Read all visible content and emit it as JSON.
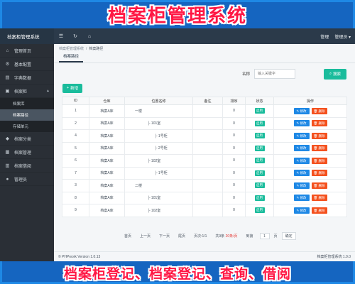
{
  "banner": {
    "top": "档案柜管理系统",
    "bottom": "档案柜登记、档案登记、查询、借阅"
  },
  "topbar": {
    "brand": "档案柜管理系统",
    "right_manage": "管理",
    "right_user": "管理员 ▾"
  },
  "sidebar": {
    "items": [
      {
        "label": "管理首页",
        "icon": "home-icon"
      },
      {
        "label": "基本配置",
        "icon": "gear-icon"
      },
      {
        "label": "字典数据",
        "icon": "book-icon"
      },
      {
        "label": "档案柜",
        "icon": "cabinet-icon"
      },
      {
        "label": "档案分类",
        "icon": "tag-icon"
      },
      {
        "label": "档案管理",
        "icon": "folder-icon"
      },
      {
        "label": "档案借阅",
        "icon": "list-icon"
      },
      {
        "label": "管理员",
        "icon": "user-icon"
      }
    ],
    "subitems": [
      "档案库",
      "档案路径",
      "存储单元"
    ]
  },
  "breadcrumb": {
    "parent": "档案柜管理系统",
    "current": "档案路径"
  },
  "tab": "档案路径",
  "search": {
    "label": "名称",
    "placeholder": "输入关键字",
    "button": "搜索"
  },
  "add_button": "新增",
  "table": {
    "headers": [
      "ID",
      "仓库",
      "位置名称",
      "备注",
      "排序",
      "状态",
      "操作"
    ],
    "status_label": "启用",
    "edit_label": "修改",
    "delete_label": "删除",
    "rows": [
      {
        "id": "1",
        "warehouse": "档案A库",
        "name": "一楼",
        "indent": 0,
        "sort": "0"
      },
      {
        "id": "2",
        "warehouse": "档案A库",
        "name": "├ 101室",
        "indent": 1,
        "sort": "0"
      },
      {
        "id": "4",
        "warehouse": "档案A库",
        "name": "├ 1号柜",
        "indent": 2,
        "sort": "0"
      },
      {
        "id": "5",
        "warehouse": "档案A库",
        "name": "├ 2号柜",
        "indent": 2,
        "sort": "0"
      },
      {
        "id": "6",
        "warehouse": "档案A库",
        "name": "├ 102室",
        "indent": 1,
        "sort": "0"
      },
      {
        "id": "7",
        "warehouse": "档案A库",
        "name": "├ 1号柜",
        "indent": 2,
        "sort": "0"
      },
      {
        "id": "3",
        "warehouse": "档案A库",
        "name": "二楼",
        "indent": 0,
        "sort": "0"
      },
      {
        "id": "8",
        "warehouse": "档案A库",
        "name": "├ 101室",
        "indent": 1,
        "sort": "0"
      },
      {
        "id": "9",
        "warehouse": "档案A库",
        "name": "├ 102室",
        "indent": 1,
        "sort": "0"
      }
    ]
  },
  "pager": {
    "first": "首页",
    "prev": "上一页",
    "next": "下一页",
    "last": "尾页",
    "pages": "页次:1/1",
    "total_prefix": "共9条",
    "per_page": "20条/页",
    "goto": "到第",
    "page_value": "1",
    "page_unit": "页",
    "confirm": "确定"
  },
  "footer": {
    "left": "© PHPwork Version 1.0.13",
    "right": "档案柜管理系统 1.0.0"
  }
}
